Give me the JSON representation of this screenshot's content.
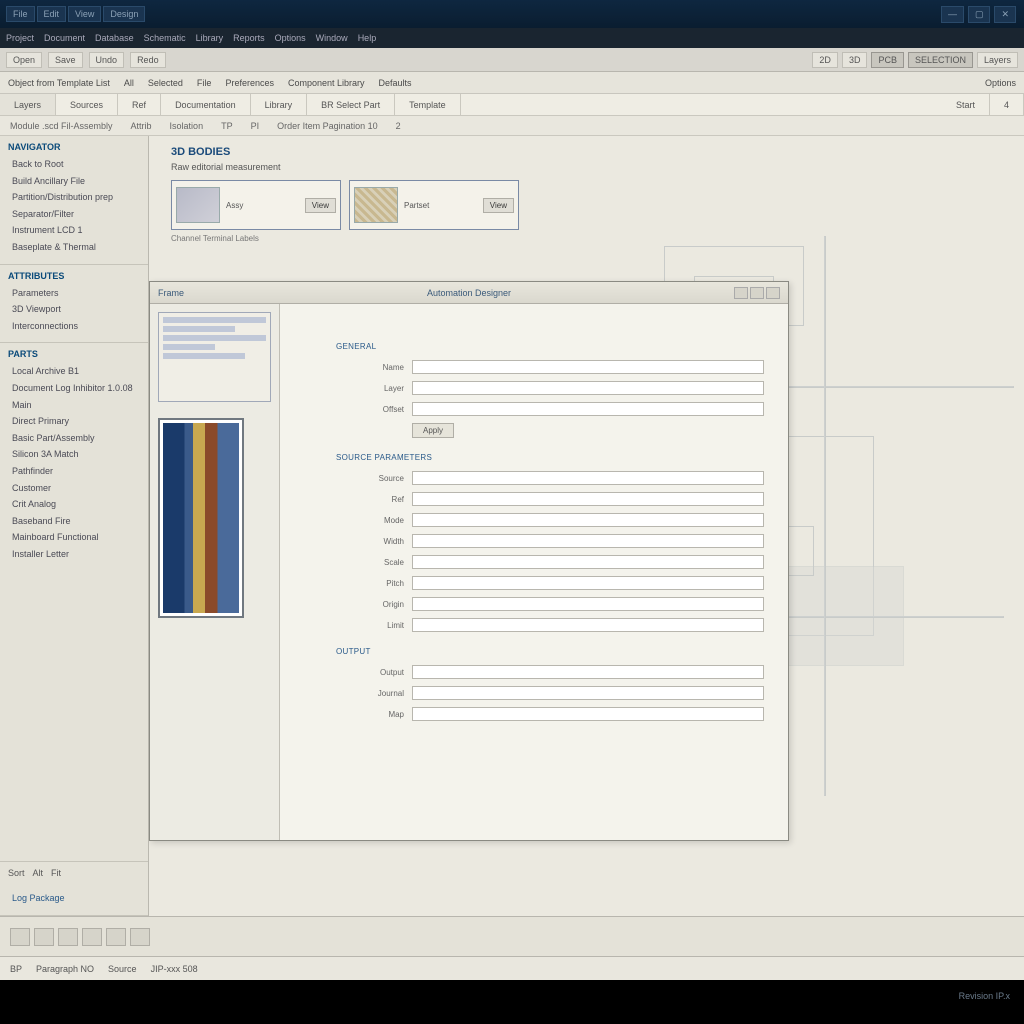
{
  "title_tabs": [
    "File",
    "Edit",
    "View",
    "Design"
  ],
  "menubar": [
    "Project",
    "Document",
    "Database",
    "Schematic",
    "Library",
    "Reports",
    "Options",
    "Window",
    "Help"
  ],
  "ribbon1": {
    "left": [
      "Open",
      "Save",
      "Undo",
      "Redo"
    ],
    "right": [
      "2D",
      "3D",
      "PCB",
      "SELECTION",
      "Layers"
    ]
  },
  "ribbon2": [
    "Object  from  Template  List",
    "All",
    "Selected",
    "File",
    "Preferences",
    "Component Library",
    "Defaults",
    "Options"
  ],
  "tabs": [
    "Layers",
    "Sources",
    "Ref",
    "Documentation",
    "Library",
    "BR Select Part",
    "Template",
    "Start",
    "4"
  ],
  "filters": [
    "Module  .scd  Fil-Assembly",
    "Attrib",
    "Isolation",
    "TP",
    "PI",
    "Order Item  Pagination  10",
    "2"
  ],
  "sidebar": {
    "sec1": {
      "h": "NAVIGATOR",
      "items": [
        "Back  to  Root",
        "Build  Ancillary File",
        "Partition/Distribution prep",
        "Separator/Filter",
        "Instrument  LCD 1",
        "Baseplate  &  Thermal"
      ]
    },
    "sec2": {
      "h": "ATTRIBUTES",
      "items": [
        "Parameters",
        "3D Viewport",
        "Interconnections"
      ]
    },
    "sec3": {
      "h": "PARTS",
      "items": [
        "Local  Archive  B1",
        "Document  Log  Inhibitor  1.0.08",
        "Main",
        "Direct  Primary",
        "Basic   Part/Assembly",
        "Silicon  3A Match",
        "Pathfinder",
        "Customer",
        "Crit   Analog",
        "Baseband Fire",
        "Mainboard  Functional",
        "Installer Letter"
      ]
    },
    "foot": {
      "a": "Sort",
      "b": "Alt",
      "c": "Fit"
    },
    "link": "Log  Package"
  },
  "canvas": {
    "t": "3D BODIES",
    "s": "Raw  editorial measurement"
  },
  "pcards": [
    {
      "meta": "Assy",
      "btn": "View"
    },
    {
      "meta": "Partset",
      "btn": "View"
    }
  ],
  "pcard_footer": "Channel  Terminal Labels",
  "subwin": {
    "title": "Automation Designer",
    "tleft": "Frame"
  },
  "form": {
    "sec1": "General",
    "rows1": [
      [
        "Name",
        ""
      ],
      [
        "Layer",
        ""
      ],
      [
        "Offset",
        ""
      ]
    ],
    "btn1": "Apply",
    "sec2": "Source Parameters",
    "rows2": [
      [
        "Source",
        ""
      ],
      [
        "Ref",
        ""
      ],
      [
        "Mode",
        ""
      ],
      [
        "Width",
        ""
      ],
      [
        "Scale",
        ""
      ],
      [
        "Pitch",
        ""
      ],
      [
        "Origin",
        ""
      ],
      [
        "Limit",
        ""
      ]
    ],
    "sec3": "Output",
    "rows3": [
      [
        "Output",
        ""
      ],
      [
        "Journal",
        ""
      ],
      [
        "Map",
        ""
      ]
    ]
  },
  "status": {
    "a": "BP",
    "b": "Paragraph  NO",
    "c": "Source",
    "d": "JIP-xxx  508"
  },
  "black": "Revision  IP.x"
}
